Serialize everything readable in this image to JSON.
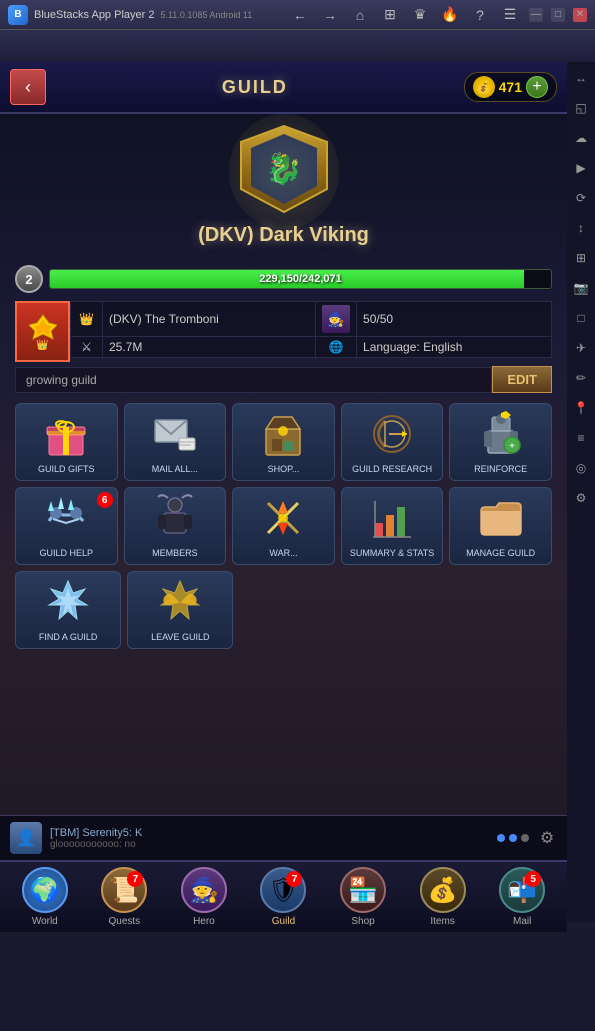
{
  "titlebar": {
    "app_name": "BlueStacks App Player 2",
    "version": "5.11.0.1085  Android 11"
  },
  "header": {
    "title": "GUILD",
    "currency_amount": "471",
    "back_label": "‹"
  },
  "guild": {
    "name": "(DKV) Dark Viking",
    "level": "2",
    "xp_current": "229,150",
    "xp_max": "242,071",
    "xp_label": "229,150/242,071",
    "xp_percent": 94.7,
    "leader_tag": "(DKV) The Tromboni",
    "members": "50/50",
    "power": "25.7M",
    "language": "Language: English",
    "description": "growing guild",
    "edit_label": "EDIT"
  },
  "menu_items": [
    {
      "id": "guild-gifts",
      "label": "GUILD GIFTS",
      "icon": "🎁",
      "badge": null
    },
    {
      "id": "mail-all",
      "label": "MAIL ALL...",
      "icon": "✉",
      "badge": null
    },
    {
      "id": "shop",
      "label": "SHOP...",
      "icon": "🏺",
      "badge": null
    },
    {
      "id": "guild-research",
      "label": "GUILD RESEARCH",
      "icon": "🏹",
      "badge": null
    },
    {
      "id": "reinforce",
      "label": "REINFORCE",
      "icon": "⚔",
      "badge": null
    },
    {
      "id": "guild-help",
      "label": "GUILD HELP",
      "icon": "🤝",
      "badge": "6"
    },
    {
      "id": "members",
      "label": "MEMBERS",
      "icon": "👤",
      "badge": null
    },
    {
      "id": "war",
      "label": "WAR...",
      "icon": "⚡",
      "badge": null
    },
    {
      "id": "summary-stats",
      "label": "SUMMARY & STATS",
      "icon": "📊",
      "badge": null
    },
    {
      "id": "manage-guild",
      "label": "MANAGE GUILD",
      "icon": "📁",
      "badge": null
    },
    {
      "id": "find-guild",
      "label": "FIND A GUILD",
      "icon": "❄",
      "badge": null
    },
    {
      "id": "leave-guild",
      "label": "LEAVE GUILD",
      "icon": "🦅",
      "badge": null
    }
  ],
  "chat": {
    "player_name": "[TBM] Serenity5: K",
    "message": "glooooooooooo: no"
  },
  "bottom_nav": [
    {
      "id": "world",
      "label": "World",
      "icon": "🌍",
      "style": "world",
      "badge": null,
      "active": false
    },
    {
      "id": "quests",
      "label": "Quests",
      "icon": "📜",
      "style": "quest",
      "badge": "7",
      "active": false
    },
    {
      "id": "hero",
      "label": "Hero",
      "icon": "🧙",
      "style": "hero",
      "badge": null,
      "active": false
    },
    {
      "id": "guild",
      "label": "Guild",
      "icon": "🛡",
      "style": "guild-nav",
      "badge": "7",
      "active": true
    },
    {
      "id": "shop",
      "label": "Shop",
      "icon": "🏪",
      "style": "shop",
      "badge": null,
      "active": false
    },
    {
      "id": "items",
      "label": "Items",
      "icon": "💰",
      "style": "items",
      "badge": null,
      "active": false
    },
    {
      "id": "mail",
      "label": "Mail",
      "icon": "📬",
      "style": "mail",
      "badge": "5",
      "active": false
    }
  ],
  "sidebar_icons": [
    "↔",
    "◱",
    "☁",
    "▶",
    "⟳",
    "↕",
    "⊞",
    "📷",
    "□",
    "✈",
    "✏",
    "📍",
    "≡",
    "⊙",
    "⚙"
  ],
  "icons": {
    "search": "🔍",
    "gear": "⚙",
    "back": "‹",
    "minimize": "—",
    "maximize": "□",
    "close": "✕",
    "home": "⌂",
    "grid": "⊞",
    "crown": "👑",
    "shield": "🛡"
  }
}
